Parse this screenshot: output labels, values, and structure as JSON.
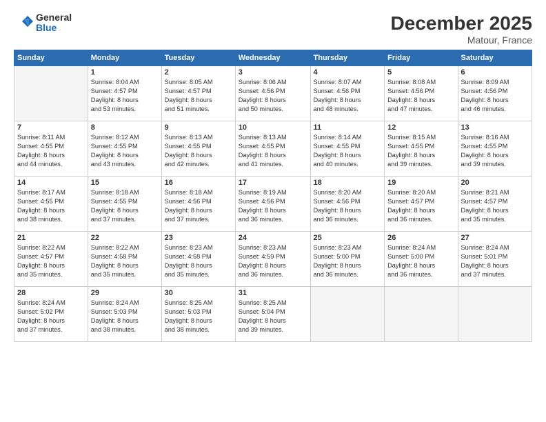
{
  "logo": {
    "general": "General",
    "blue": "Blue"
  },
  "title": "December 2025",
  "location": "Matour, France",
  "days_of_week": [
    "Sunday",
    "Monday",
    "Tuesday",
    "Wednesday",
    "Thursday",
    "Friday",
    "Saturday"
  ],
  "weeks": [
    [
      {
        "day": "",
        "info": ""
      },
      {
        "day": "1",
        "info": "Sunrise: 8:04 AM\nSunset: 4:57 PM\nDaylight: 8 hours\nand 53 minutes."
      },
      {
        "day": "2",
        "info": "Sunrise: 8:05 AM\nSunset: 4:57 PM\nDaylight: 8 hours\nand 51 minutes."
      },
      {
        "day": "3",
        "info": "Sunrise: 8:06 AM\nSunset: 4:56 PM\nDaylight: 8 hours\nand 50 minutes."
      },
      {
        "day": "4",
        "info": "Sunrise: 8:07 AM\nSunset: 4:56 PM\nDaylight: 8 hours\nand 48 minutes."
      },
      {
        "day": "5",
        "info": "Sunrise: 8:08 AM\nSunset: 4:56 PM\nDaylight: 8 hours\nand 47 minutes."
      },
      {
        "day": "6",
        "info": "Sunrise: 8:09 AM\nSunset: 4:56 PM\nDaylight: 8 hours\nand 46 minutes."
      }
    ],
    [
      {
        "day": "7",
        "info": "Sunrise: 8:11 AM\nSunset: 4:55 PM\nDaylight: 8 hours\nand 44 minutes."
      },
      {
        "day": "8",
        "info": "Sunrise: 8:12 AM\nSunset: 4:55 PM\nDaylight: 8 hours\nand 43 minutes."
      },
      {
        "day": "9",
        "info": "Sunrise: 8:13 AM\nSunset: 4:55 PM\nDaylight: 8 hours\nand 42 minutes."
      },
      {
        "day": "10",
        "info": "Sunrise: 8:13 AM\nSunset: 4:55 PM\nDaylight: 8 hours\nand 41 minutes."
      },
      {
        "day": "11",
        "info": "Sunrise: 8:14 AM\nSunset: 4:55 PM\nDaylight: 8 hours\nand 40 minutes."
      },
      {
        "day": "12",
        "info": "Sunrise: 8:15 AM\nSunset: 4:55 PM\nDaylight: 8 hours\nand 39 minutes."
      },
      {
        "day": "13",
        "info": "Sunrise: 8:16 AM\nSunset: 4:55 PM\nDaylight: 8 hours\nand 39 minutes."
      }
    ],
    [
      {
        "day": "14",
        "info": "Sunrise: 8:17 AM\nSunset: 4:55 PM\nDaylight: 8 hours\nand 38 minutes."
      },
      {
        "day": "15",
        "info": "Sunrise: 8:18 AM\nSunset: 4:55 PM\nDaylight: 8 hours\nand 37 minutes."
      },
      {
        "day": "16",
        "info": "Sunrise: 8:18 AM\nSunset: 4:56 PM\nDaylight: 8 hours\nand 37 minutes."
      },
      {
        "day": "17",
        "info": "Sunrise: 8:19 AM\nSunset: 4:56 PM\nDaylight: 8 hours\nand 36 minutes."
      },
      {
        "day": "18",
        "info": "Sunrise: 8:20 AM\nSunset: 4:56 PM\nDaylight: 8 hours\nand 36 minutes."
      },
      {
        "day": "19",
        "info": "Sunrise: 8:20 AM\nSunset: 4:57 PM\nDaylight: 8 hours\nand 36 minutes."
      },
      {
        "day": "20",
        "info": "Sunrise: 8:21 AM\nSunset: 4:57 PM\nDaylight: 8 hours\nand 35 minutes."
      }
    ],
    [
      {
        "day": "21",
        "info": "Sunrise: 8:22 AM\nSunset: 4:57 PM\nDaylight: 8 hours\nand 35 minutes."
      },
      {
        "day": "22",
        "info": "Sunrise: 8:22 AM\nSunset: 4:58 PM\nDaylight: 8 hours\nand 35 minutes."
      },
      {
        "day": "23",
        "info": "Sunrise: 8:23 AM\nSunset: 4:58 PM\nDaylight: 8 hours\nand 35 minutes."
      },
      {
        "day": "24",
        "info": "Sunrise: 8:23 AM\nSunset: 4:59 PM\nDaylight: 8 hours\nand 36 minutes."
      },
      {
        "day": "25",
        "info": "Sunrise: 8:23 AM\nSunset: 5:00 PM\nDaylight: 8 hours\nand 36 minutes."
      },
      {
        "day": "26",
        "info": "Sunrise: 8:24 AM\nSunset: 5:00 PM\nDaylight: 8 hours\nand 36 minutes."
      },
      {
        "day": "27",
        "info": "Sunrise: 8:24 AM\nSunset: 5:01 PM\nDaylight: 8 hours\nand 37 minutes."
      }
    ],
    [
      {
        "day": "28",
        "info": "Sunrise: 8:24 AM\nSunset: 5:02 PM\nDaylight: 8 hours\nand 37 minutes."
      },
      {
        "day": "29",
        "info": "Sunrise: 8:24 AM\nSunset: 5:03 PM\nDaylight: 8 hours\nand 38 minutes."
      },
      {
        "day": "30",
        "info": "Sunrise: 8:25 AM\nSunset: 5:03 PM\nDaylight: 8 hours\nand 38 minutes."
      },
      {
        "day": "31",
        "info": "Sunrise: 8:25 AM\nSunset: 5:04 PM\nDaylight: 8 hours\nand 39 minutes."
      },
      {
        "day": "",
        "info": ""
      },
      {
        "day": "",
        "info": ""
      },
      {
        "day": "",
        "info": ""
      }
    ]
  ]
}
